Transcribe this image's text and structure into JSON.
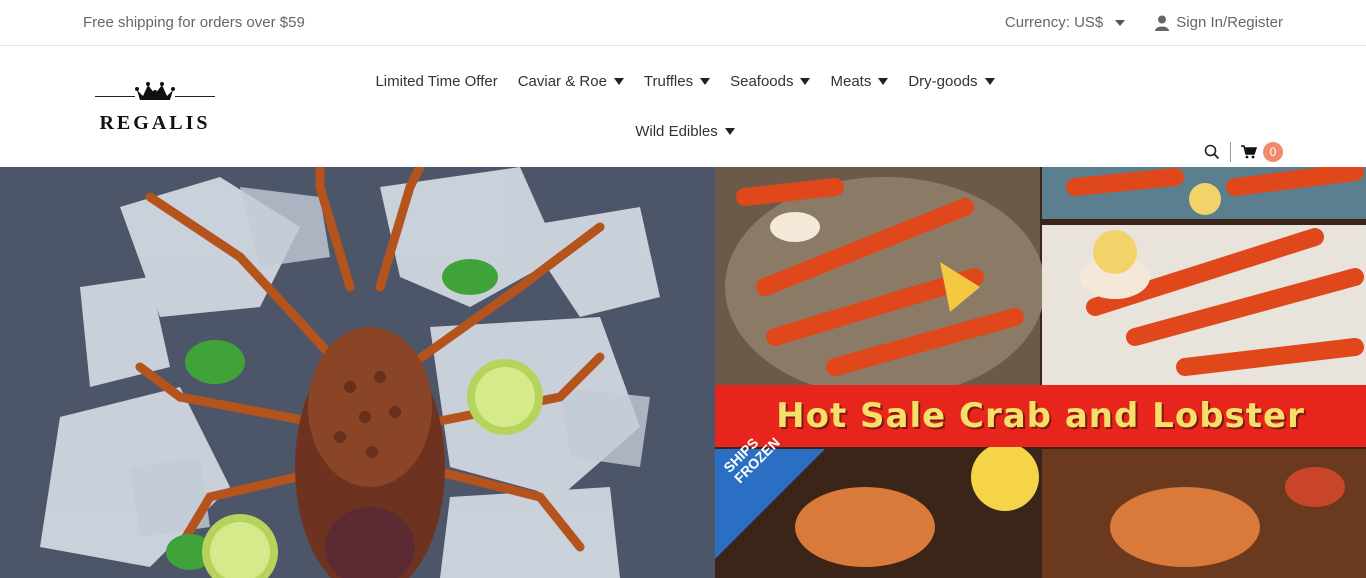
{
  "topbar": {
    "shipping": "Free shipping for orders over $59",
    "currency": "Currency: US$",
    "signin": "Sign In/Register"
  },
  "logo": {
    "text": "REGALIS"
  },
  "nav": {
    "items": [
      {
        "label": "Limited Time Offer",
        "dropdown": false
      },
      {
        "label": "Caviar & Roe",
        "dropdown": true
      },
      {
        "label": "Truffles",
        "dropdown": true
      },
      {
        "label": "Seafoods",
        "dropdown": true
      },
      {
        "label": "Meats",
        "dropdown": true
      },
      {
        "label": "Dry-goods",
        "dropdown": true
      },
      {
        "label": "Wild Edibles",
        "dropdown": true
      }
    ]
  },
  "cart": {
    "count": "0"
  },
  "hero": {
    "banner_text": "Hot Sale Crab and Lobster",
    "ships_text": "SHIPS FROZEN"
  },
  "colors": {
    "badge": "#f08a6a",
    "sale_band": "#e8251c",
    "sale_text": "#f6e06a"
  }
}
